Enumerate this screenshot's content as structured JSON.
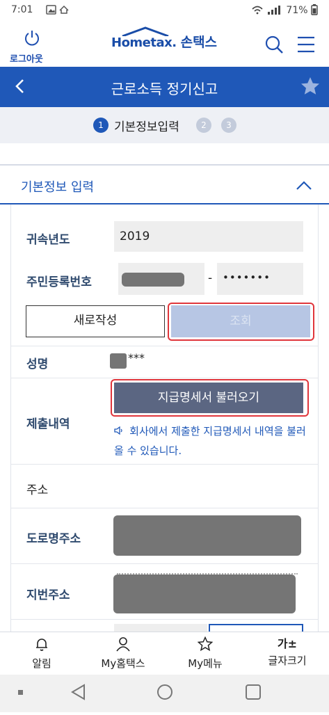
{
  "status_bar": {
    "time": "7:01",
    "battery": "71%"
  },
  "header": {
    "logout_label": "로그아웃",
    "logo_brand_en": "Hometax.",
    "logo_brand_ko": "손택스"
  },
  "title_bar": {
    "title": "근로소득 정기신고"
  },
  "steps": {
    "current_number": "1",
    "current_label": "기본정보입력",
    "step2": "2",
    "step3": "3"
  },
  "section": {
    "title": "기본정보 입력"
  },
  "form": {
    "year_label": "귀속년도",
    "year_value": "2019",
    "rrn_label": "주민등록번호",
    "rrn_dash": "-",
    "rrn_back_masked": "•••••••",
    "new_button": "새로작성",
    "lookup_button": "조회",
    "name_label": "성명",
    "name_masked_suffix": "***",
    "submission_label": "제출내역",
    "load_button": "지급명세서 불러오기",
    "notice_text": "회사에서 제출한 지급명세서 내역을 불러올 수 있습니다.",
    "address_label": "주소",
    "road_address_label": "도로명주소",
    "lot_address_label": "지번주소"
  },
  "bottom_nav": {
    "items": [
      {
        "label": "알림",
        "icon": "bell-icon"
      },
      {
        "label": "My홈택스",
        "icon": "person-icon"
      },
      {
        "label": "My메뉴",
        "icon": "star-outline-icon"
      },
      {
        "label": "글자크기",
        "icon": "font-size-icon",
        "glyph": "가±"
      }
    ]
  },
  "colors": {
    "primary": "#1f58b8",
    "label_navy": "#2f4a6e",
    "highlight_red": "#e0353b",
    "load_button_bg": "#5b6682",
    "lookup_disabled_bg": "#b7c6e4"
  }
}
